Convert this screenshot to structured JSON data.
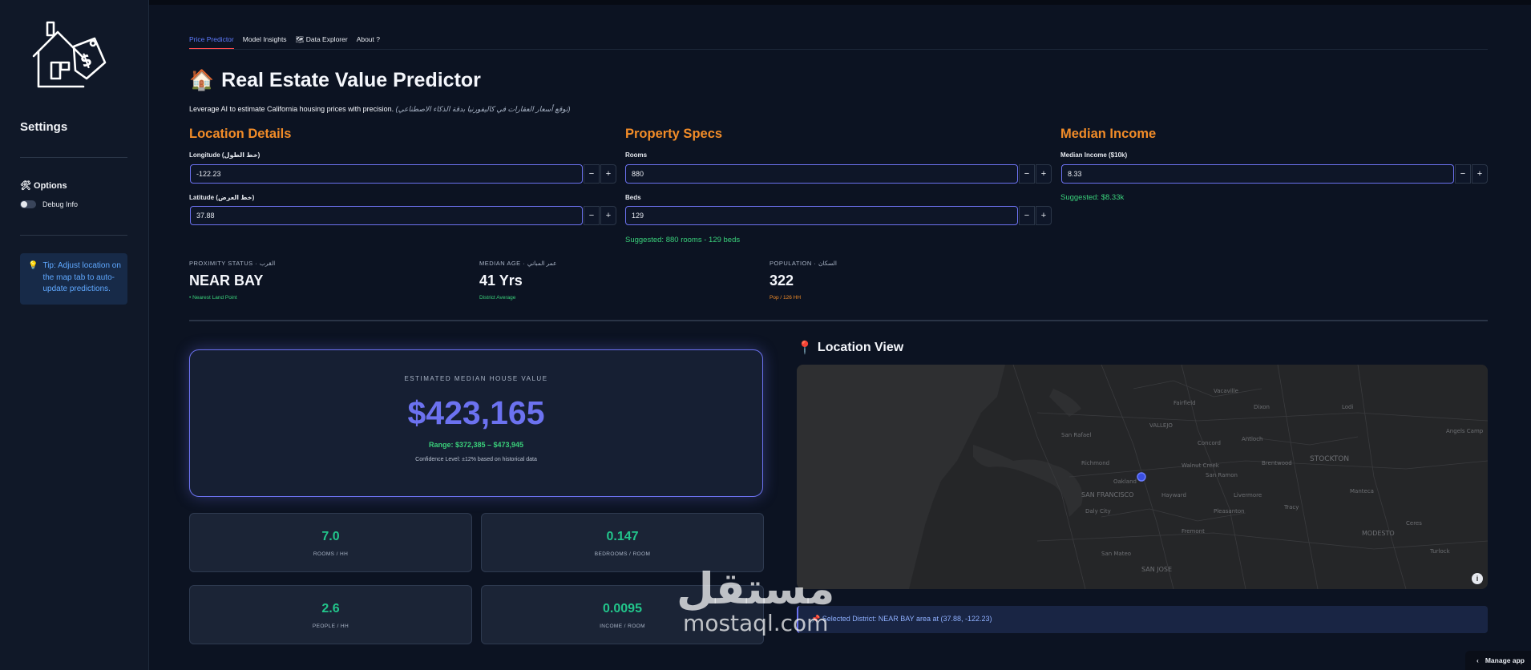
{
  "sidebar": {
    "title": "Settings",
    "options_title": "🛠 Options",
    "debug_label": "Debug Info",
    "tip_icon": "💡",
    "tip_text": "Tip: Adjust location on the map tab to auto-update predictions."
  },
  "tabs": [
    "Price Predictor",
    "Model Insights",
    "🗺 Data Explorer",
    "About ?"
  ],
  "header": {
    "icon": "🏠",
    "title": "Real Estate Value Predictor",
    "subtitle": "Leverage AI to estimate California housing prices with precision.",
    "subtitle_ar": "(توقع أسعار العقارات في كاليفورنيا بدقة الذكاء الاصطناعي)"
  },
  "location": {
    "title": "Location Details",
    "longitude_label": "Longitude (خط الطول)",
    "longitude": "-122.23",
    "latitude_label": "Latitude (خط العرض)",
    "latitude": "37.88"
  },
  "property": {
    "title": "Property Specs",
    "rooms_label": "Rooms",
    "rooms": "880",
    "beds_label": "Beds",
    "beds": "129",
    "suggestion": "Suggested: 880 rooms - 129 beds"
  },
  "income": {
    "title": "Median Income",
    "label": "Median Income ($10k)",
    "value": "8.33",
    "suggestion": "Suggested: $8.33k"
  },
  "buttons": {
    "minus": "−",
    "plus": "+"
  },
  "metrics": [
    {
      "label": "PROXIMITY STATUS · القرب",
      "value": "NEAR BAY",
      "note": "• Nearest Land Point"
    },
    {
      "label": "MEDIAN AGE · عمر المباني",
      "value": "41 Yrs",
      "note": "District Average"
    },
    {
      "label": "POPULATION · السكان",
      "value": "322",
      "note": "Pop / 126 HH"
    }
  ],
  "estimate": {
    "label": "ESTIMATED MEDIAN HOUSE VALUE",
    "value": "$423,165",
    "range": "Range: $372,385 – $473,945",
    "confidence": "Confidence Level: ±12% based on historical data"
  },
  "stats": [
    {
      "value": "7.0",
      "label": "ROOMS / HH"
    },
    {
      "value": "0.147",
      "label": "BEDROOMS / ROOM"
    },
    {
      "value": "2.6",
      "label": "PEOPLE / HH"
    },
    {
      "value": "0.0095",
      "label": "INCOME / ROOM"
    }
  ],
  "map": {
    "title_icon": "📍",
    "title": "Location View",
    "labels": [
      "STOCKTON",
      "SAN FRANCISCO",
      "MODESTO",
      "VALLEJO",
      "Richmond",
      "Oakland",
      "Fremont",
      "Daly City",
      "San Mateo",
      "Concord",
      "Antioch",
      "Tracy",
      "Hayward",
      "Livermore",
      "San Rafael",
      "Walnut Creek",
      "Pleasanton",
      "Brentwood",
      "Lodi",
      "Vacaville",
      "Fairfield",
      "Dixon",
      "Manteca",
      "San Ramon",
      "Ceres",
      "Turlock",
      "Angels Camp",
      "SAN JOSE"
    ],
    "marker_lat": 37.88,
    "marker_lon": -122.23,
    "info_symbol": "i",
    "selected_icon": "📌",
    "selected_text": "Selected District: NEAR BAY area at (37.88, -122.23)"
  },
  "watermark": {
    "line1": "مستقل",
    "line2": "mostaql.com"
  },
  "manage_app": "Manage app",
  "manage_icon": "‹",
  "colors": {
    "accent": "#6c72f0",
    "orange": "#f28c28",
    "green": "#3ad17b",
    "teal": "#22c58b",
    "background": "#0c1322"
  }
}
